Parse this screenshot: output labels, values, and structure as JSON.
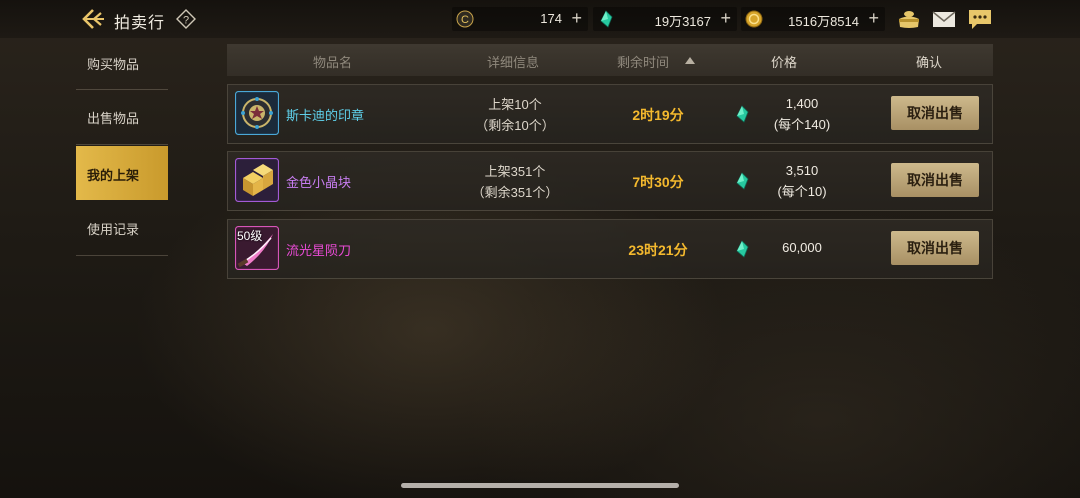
{
  "header": {
    "title": "拍卖行",
    "resources": [
      {
        "icon": "gold-coin-c-icon",
        "value": "174"
      },
      {
        "icon": "green-gem-icon",
        "value": "19万3167"
      },
      {
        "icon": "gold-medal-icon",
        "value": "1516万8514"
      }
    ]
  },
  "sidebar": {
    "items": [
      {
        "label": "购买物品"
      },
      {
        "label": "出售物品"
      },
      {
        "label": "我的上架"
      },
      {
        "label": "使用记录"
      }
    ],
    "active": "我的上架"
  },
  "table": {
    "columns": [
      "物品名",
      "详细信息",
      "剩余时间",
      "价格",
      "确认"
    ],
    "rows": [
      {
        "name": "斯卡迪的印章",
        "name_color": "#5fd0ea",
        "detail1": "上架10个",
        "detail2": "（剩余10个）",
        "time": "2时19分",
        "price1": "1,400",
        "price2": "(每个140)",
        "button": "取消出售",
        "icon": "seal-icon"
      },
      {
        "name": "金色小晶块",
        "name_color": "#c77df0",
        "detail1": "上架351个",
        "detail2": "（剩余351个）",
        "time": "7时30分",
        "price1": "3,510",
        "price2": "(每个10)",
        "button": "取消出售",
        "icon": "gold-crystal-icon"
      },
      {
        "name": "流光星陨刀",
        "name_color": "#e94bd6",
        "detail1": "",
        "detail2": "",
        "time": "23时21分",
        "price1": "60,000",
        "price2": "",
        "button": "取消出售",
        "icon": "blade-icon",
        "badge": "50级"
      }
    ]
  },
  "colors": {
    "accent_gold": "#e3b94a",
    "time_orange": "#f4b92e",
    "button_tan": "#cdb98c"
  }
}
